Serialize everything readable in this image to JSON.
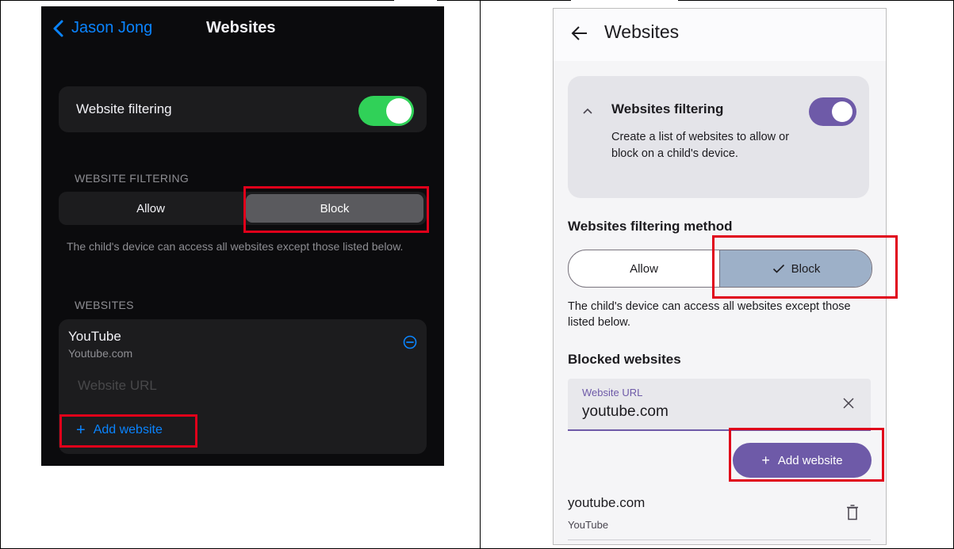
{
  "ios": {
    "back_label": "Jason Jong",
    "title": "Websites",
    "filter_toggle_label": "Website filtering",
    "filter_toggle_on": true,
    "section_filter_header": "WEBSITE FILTERING",
    "segment_allow": "Allow",
    "segment_block": "Block",
    "selected_segment": "Block",
    "description": "The child's device can access all websites except those listed below.",
    "section_websites_header": "WEBSITES",
    "site_name": "YouTube",
    "site_domain": "Youtube.com",
    "url_placeholder": "Website URL",
    "add_website": "Add website",
    "colors": {
      "accent": "#0a84ff",
      "toggle_on": "#30d158",
      "background": "#0b0b0d",
      "card": "#1c1c1e"
    }
  },
  "android": {
    "title": "Websites",
    "filter_title": "Websites filtering",
    "filter_description": "Create a list of websites to allow or block on a child's device.",
    "filter_toggle_on": true,
    "method_title": "Websites filtering method",
    "segment_allow": "Allow",
    "segment_block": "Block",
    "selected_segment": "Block",
    "method_description": "The child's device can access all websites except those listed below.",
    "blocked_title": "Blocked websites",
    "url_label": "Website URL",
    "url_value": "youtube.com",
    "add_website": "Add website",
    "site_row_title": "youtube.com",
    "site_row_subtitle": "YouTube",
    "colors": {
      "primary": "#6e5aa8",
      "segment_selected": "#9db0c8",
      "surface": "#f5f5f7"
    }
  },
  "annotation_color": "#e0001a"
}
